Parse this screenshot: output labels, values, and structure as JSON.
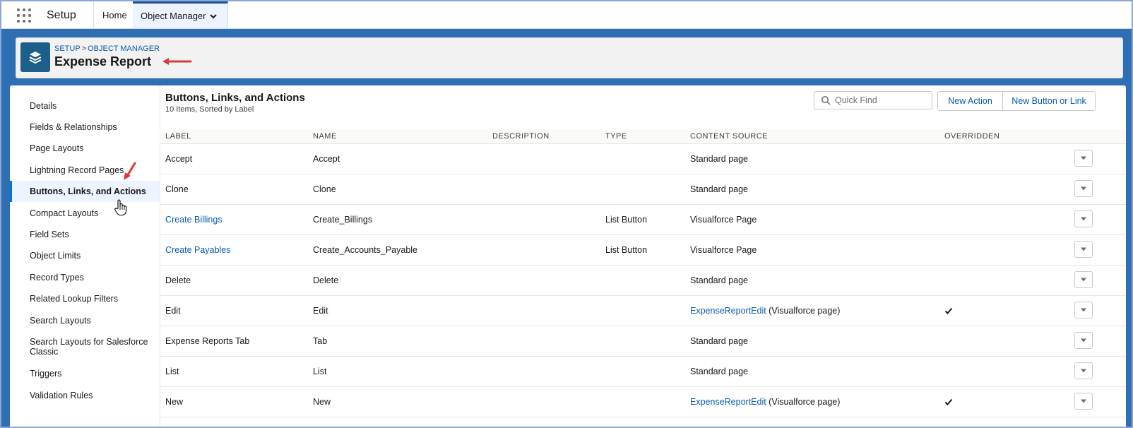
{
  "topbar": {
    "app_name": "Setup",
    "tabs": [
      {
        "label": "Home"
      },
      {
        "label": "Object Manager"
      }
    ]
  },
  "header": {
    "breadcrumb": [
      "SETUP",
      "OBJECT MANAGER"
    ],
    "breadcrumb_sep": ">",
    "title": "Expense Report"
  },
  "sidebar": {
    "items": [
      {
        "label": "Details"
      },
      {
        "label": "Fields & Relationships"
      },
      {
        "label": "Page Layouts"
      },
      {
        "label": "Lightning Record Pages"
      },
      {
        "label": "Buttons, Links, and Actions",
        "active": true
      },
      {
        "label": "Compact Layouts"
      },
      {
        "label": "Field Sets"
      },
      {
        "label": "Object Limits"
      },
      {
        "label": "Record Types"
      },
      {
        "label": "Related Lookup Filters"
      },
      {
        "label": "Search Layouts"
      },
      {
        "label": "Search Layouts for Salesforce Classic"
      },
      {
        "label": "Triggers"
      },
      {
        "label": "Validation Rules"
      }
    ]
  },
  "main": {
    "title": "Buttons, Links, and Actions",
    "subtitle": "10 Items, Sorted by Label",
    "quick_find_placeholder": "Quick Find",
    "new_action_label": "New Action",
    "new_button_label": "New Button or Link",
    "columns": [
      "LABEL",
      "NAME",
      "DESCRIPTION",
      "TYPE",
      "CONTENT SOURCE",
      "OVERRIDDEN"
    ],
    "rows": [
      {
        "label": "Accept",
        "label_link": false,
        "name": "Accept",
        "description": "",
        "type": "",
        "source_link": "",
        "source_text": "Standard page",
        "overridden": false
      },
      {
        "label": "Clone",
        "label_link": false,
        "name": "Clone",
        "description": "",
        "type": "",
        "source_link": "",
        "source_text": "Standard page",
        "overridden": false
      },
      {
        "label": "Create Billings",
        "label_link": true,
        "name": "Create_Billings",
        "description": "",
        "type": "List Button",
        "source_link": "",
        "source_text": "Visualforce Page",
        "overridden": false
      },
      {
        "label": "Create Payables",
        "label_link": true,
        "name": "Create_Accounts_Payable",
        "description": "",
        "type": "List Button",
        "source_link": "",
        "source_text": "Visualforce Page",
        "overridden": false
      },
      {
        "label": "Delete",
        "label_link": false,
        "name": "Delete",
        "description": "",
        "type": "",
        "source_link": "",
        "source_text": "Standard page",
        "overridden": false
      },
      {
        "label": "Edit",
        "label_link": false,
        "name": "Edit",
        "description": "",
        "type": "",
        "source_link": "ExpenseReportEdit",
        "source_text": " (Visualforce page)",
        "overridden": true
      },
      {
        "label": "Expense Reports Tab",
        "label_link": false,
        "name": "Tab",
        "description": "",
        "type": "",
        "source_link": "",
        "source_text": "Standard page",
        "overridden": false
      },
      {
        "label": "List",
        "label_link": false,
        "name": "List",
        "description": "",
        "type": "",
        "source_link": "",
        "source_text": "Standard page",
        "overridden": false
      },
      {
        "label": "New",
        "label_link": false,
        "name": "New",
        "description": "",
        "type": "",
        "source_link": "ExpenseReportEdit",
        "source_text": " (Visualforce page)",
        "overridden": true
      }
    ]
  },
  "colors": {
    "brand_blue": "#0176d3",
    "link_blue": "#0b5cab",
    "annotation_red": "#d93a36",
    "background_blue": "#2e6fb3"
  },
  "icons": [
    "app-launcher-icon",
    "chevron-down-icon",
    "object-stack-icon",
    "search-icon",
    "check-icon",
    "row-menu-icon",
    "hand-cursor-icon",
    "red-arrow-icon"
  ]
}
